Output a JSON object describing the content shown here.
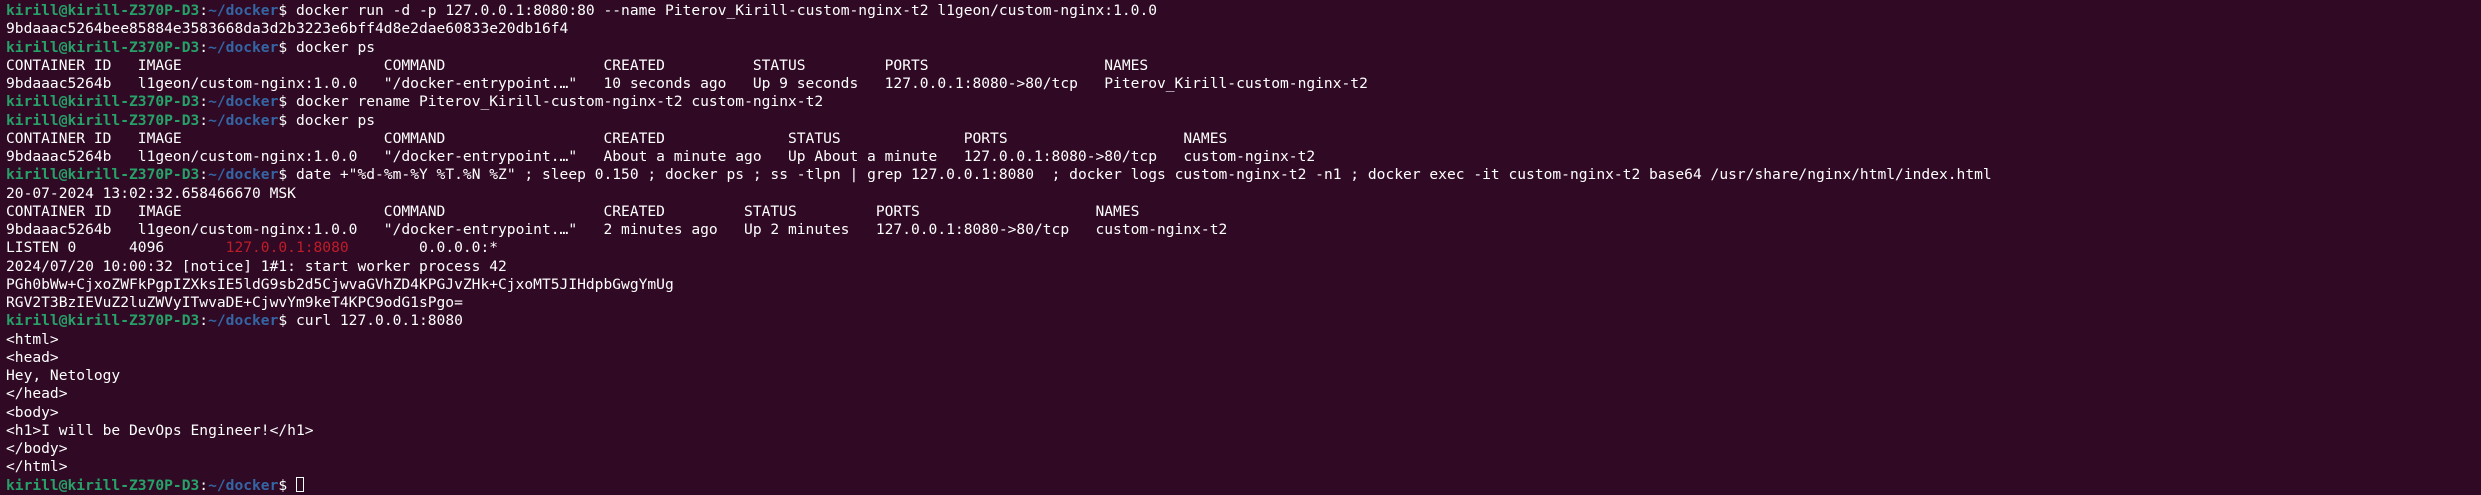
{
  "terminal": {
    "prompt": {
      "user_host": "kirill@kirill-Z370P-D3",
      "separator": ":",
      "path": "~/docker",
      "symbol": "$ "
    },
    "colors": {
      "background": "#300a24",
      "text": "#ffffff",
      "user_host": "#26a269",
      "path": "#3465a4",
      "highlight": "#c01c28"
    },
    "lines": [
      {
        "kind": "prompt",
        "command": "docker run -d -p 127.0.0.1:8080:80 --name Piterov_Kirill-custom-nginx-t2 l1geon/custom-nginx:1.0.0"
      },
      {
        "kind": "output",
        "text": "9bdaaac5264bee85884e3583668da3d2b3223e6bff4d8e2dae60833e20db16f4"
      },
      {
        "kind": "prompt",
        "command": "docker ps"
      },
      {
        "kind": "output",
        "text": "CONTAINER ID   IMAGE                       COMMAND                  CREATED          STATUS         PORTS                    NAMES"
      },
      {
        "kind": "output",
        "text": "9bdaaac5264b   l1geon/custom-nginx:1.0.0   \"/docker-entrypoint.…\"   10 seconds ago   Up 9 seconds   127.0.0.1:8080->80/tcp   Piterov_Kirill-custom-nginx-t2"
      },
      {
        "kind": "prompt",
        "command": "docker rename Piterov_Kirill-custom-nginx-t2 custom-nginx-t2"
      },
      {
        "kind": "prompt",
        "command": "docker ps"
      },
      {
        "kind": "output",
        "text": "CONTAINER ID   IMAGE                       COMMAND                  CREATED              STATUS              PORTS                    NAMES"
      },
      {
        "kind": "output",
        "text": "9bdaaac5264b   l1geon/custom-nginx:1.0.0   \"/docker-entrypoint.…\"   About a minute ago   Up About a minute   127.0.0.1:8080->80/tcp   custom-nginx-t2"
      },
      {
        "kind": "prompt",
        "command": "date +\"%d-%m-%Y %T.%N %Z\" ; sleep 0.150 ; docker ps ; ss -tlpn | grep 127.0.0.1:8080  ; docker logs custom-nginx-t2 -n1 ; docker exec -it custom-nginx-t2 base64 /usr/share/nginx/html/index.html"
      },
      {
        "kind": "output",
        "text": "20-07-2024 13:02:32.658466670 MSK"
      },
      {
        "kind": "output",
        "text": "CONTAINER ID   IMAGE                       COMMAND                  CREATED         STATUS         PORTS                    NAMES"
      },
      {
        "kind": "output",
        "text": "9bdaaac5264b   l1geon/custom-nginx:1.0.0   \"/docker-entrypoint.…\"   2 minutes ago   Up 2 minutes   127.0.0.1:8080->80/tcp   custom-nginx-t2"
      },
      {
        "kind": "ss",
        "before": "LISTEN 0      4096       ",
        "highlight": "127.0.0.1:8080",
        "after": "        0.0.0.0:*"
      },
      {
        "kind": "output",
        "text": "2024/07/20 10:00:32 [notice] 1#1: start worker process 42"
      },
      {
        "kind": "output",
        "text": "PGh0bWw+CjxoZWFkPgpIZXksIE5ldG9sb2d5CjwvaGVhZD4KPGJvZHk+CjxoMT5JIHdpbGwgYmUg"
      },
      {
        "kind": "output",
        "text": "RGV2T3BzIEVuZ2luZWVyITwvaDE+CjwvYm9keT4KPC9odG1sPgo="
      },
      {
        "kind": "prompt",
        "command": "curl 127.0.0.1:8080"
      },
      {
        "kind": "output",
        "text": "<html>"
      },
      {
        "kind": "output",
        "text": "<head>"
      },
      {
        "kind": "output",
        "text": "Hey, Netology"
      },
      {
        "kind": "output",
        "text": "</head>"
      },
      {
        "kind": "output",
        "text": "<body>"
      },
      {
        "kind": "output",
        "text": "<h1>I will be DevOps Engineer!</h1>"
      },
      {
        "kind": "output",
        "text": "</body>"
      },
      {
        "kind": "output",
        "text": "</html>"
      },
      {
        "kind": "prompt-active",
        "command": ""
      }
    ]
  }
}
